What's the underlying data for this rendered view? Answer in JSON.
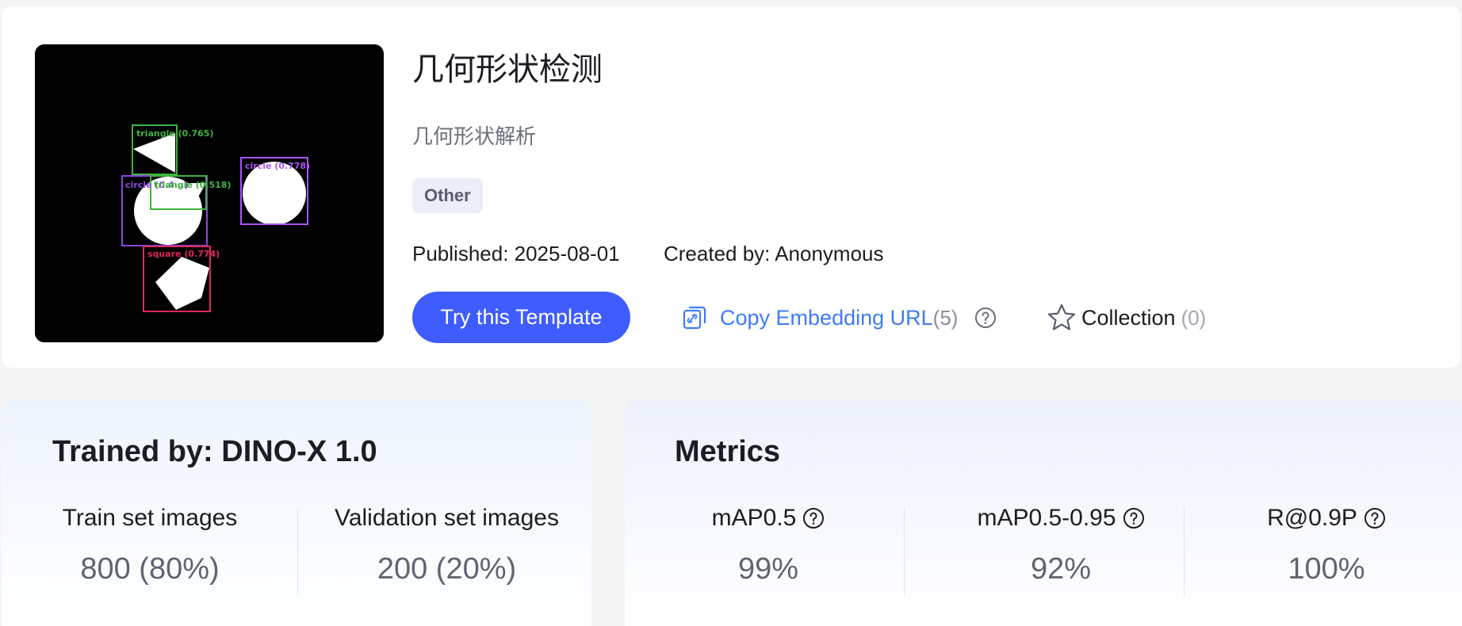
{
  "template": {
    "title": "几何形状检测",
    "subtitle": "几何形状解析",
    "tag": "Other",
    "published": "Published: 2025-08-01",
    "created_by": "Created by: Anonymous"
  },
  "thumbnail": {
    "detections": [
      {
        "label": "triangle (0.765)",
        "color": "#3db43d"
      },
      {
        "label": "circle (0.778)",
        "color": "#a855f7"
      },
      {
        "label": "circle (0.4...)",
        "color": "#8b46e0"
      },
      {
        "label": "triangle (0.518)",
        "color": "#3db43d"
      },
      {
        "label": "square (0.774)",
        "color": "#e0285a"
      }
    ]
  },
  "actions": {
    "try_label": "Try this Template",
    "copy_label": "Copy Embedding URL",
    "copy_count": "(5)",
    "collection_label": "Collection",
    "collection_count": "(0)"
  },
  "training": {
    "title": "Trained by: DINO-X 1.0",
    "stats": [
      {
        "label": "Train set images",
        "value": "800 (80%)"
      },
      {
        "label": "Validation set images",
        "value": "200 (20%)"
      }
    ]
  },
  "metrics": {
    "title": "Metrics",
    "items": [
      {
        "label": "mAP0.5",
        "value": "99%"
      },
      {
        "label": "mAP0.5-0.95",
        "value": "92%"
      },
      {
        "label": "R@0.9P",
        "value": "100%"
      }
    ]
  },
  "colors": {
    "accent": "#3f5cff",
    "link": "#3f7bf6",
    "tag_bg": "#ebedf8"
  },
  "icons": [
    "link-icon",
    "help-icon",
    "star-icon"
  ]
}
